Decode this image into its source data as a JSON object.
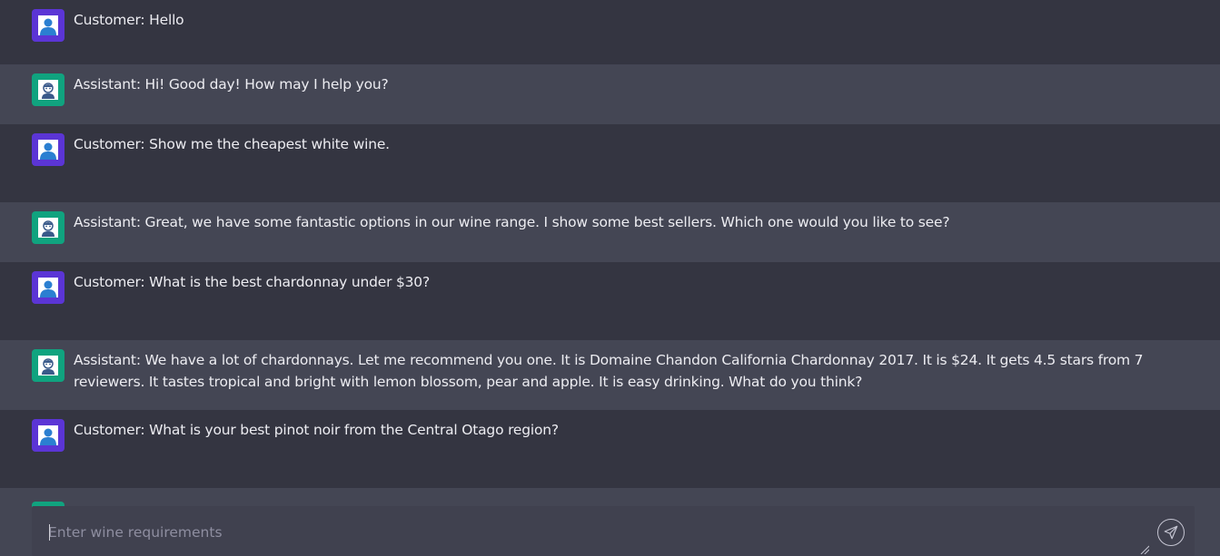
{
  "messages": [
    {
      "role": "customer",
      "text": "Customer: Hello"
    },
    {
      "role": "assistant",
      "text": "Assistant: Hi! Good day! How may I help you?"
    },
    {
      "role": "customer",
      "text": "Customer: Show me the cheapest white wine."
    },
    {
      "role": "assistant",
      "text": "Assistant: Great, we have some fantastic options in our wine range. I show some best sellers. Which one would you like to see?"
    },
    {
      "role": "customer",
      "text": "Customer: What is the best chardonnay under $30?"
    },
    {
      "role": "assistant",
      "text": "Assistant: We have a lot of chardonnays. Let me recommend you one. It is Domaine Chandon California Chardonnay 2017. It is $24. It gets 4.5 stars from 7 reviewers. It tastes tropical and bright with lemon blossom, pear and apple. It is easy drinking. What do you think?"
    },
    {
      "role": "customer",
      "text": "Customer: What is your best pinot noir from the Central Otago region?"
    },
    {
      "role": "assistant",
      "text": ""
    }
  ],
  "icons": {
    "customer_avatar": "user-icon",
    "assistant_avatar": "assistant-icon",
    "send": "send-icon"
  },
  "colors": {
    "customer_avatar_bg": "#5b35d5",
    "assistant_avatar_bg": "#10a37f",
    "customer_row_bg": "#343541",
    "assistant_row_bg": "#444654",
    "input_bg": "#40414f"
  },
  "composer": {
    "placeholder": "Enter wine requirements",
    "value": ""
  }
}
